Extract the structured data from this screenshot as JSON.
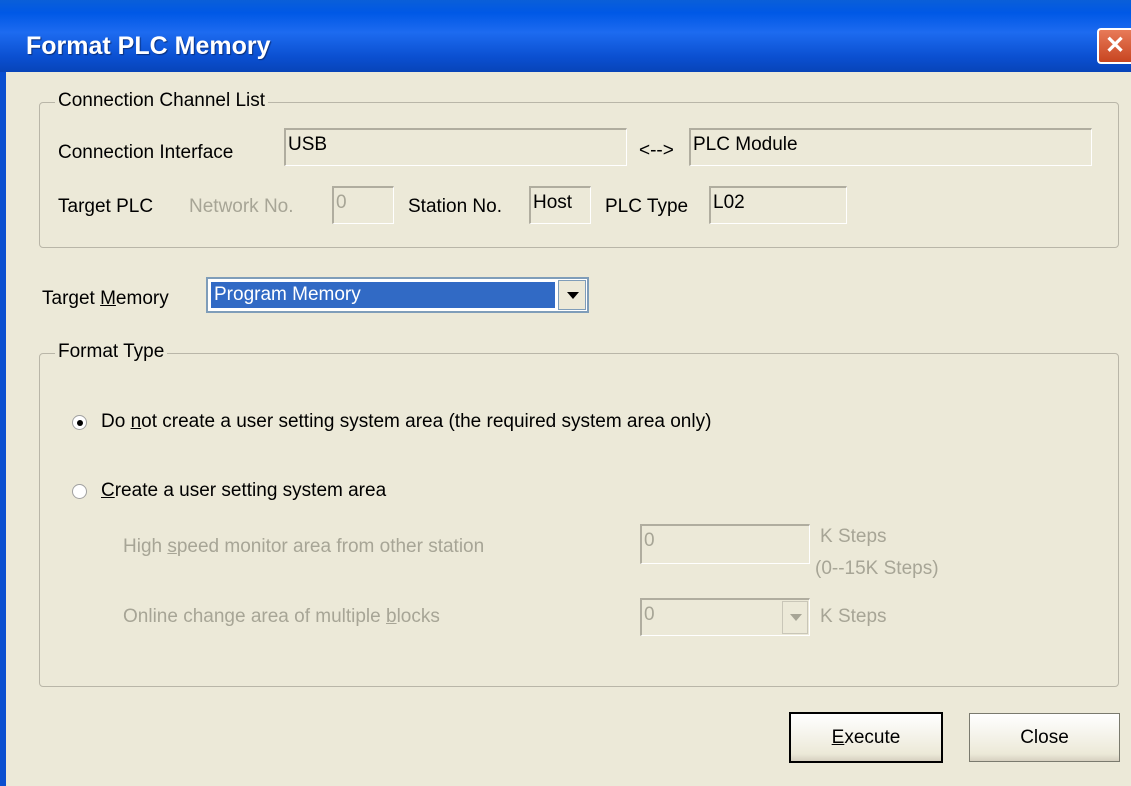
{
  "window": {
    "title": "Format PLC Memory"
  },
  "connection": {
    "group_label": "Connection Channel List",
    "interface_label": "Connection Interface",
    "interface_value": "USB",
    "arrow": "<-->",
    "module_value": "PLC Module",
    "target_plc_label": "Target PLC",
    "network_label": "Network No.",
    "network_value": "0",
    "station_label": "Station No.",
    "station_value": "Host",
    "plc_type_label": "PLC Type",
    "plc_type_value": "L02"
  },
  "target_memory": {
    "label_prefix": "Target ",
    "label_mnemonic": "M",
    "label_suffix": "emory",
    "selected": "Program Memory"
  },
  "format_type": {
    "group_label": "Format Type",
    "option1_prefix": "Do ",
    "option1_mnemonic": "n",
    "option1_suffix": "ot create a user setting system area (the required system area only)",
    "option1_selected": true,
    "option2_mnemonic": "C",
    "option2_suffix": "reate a user setting system area",
    "option2_selected": false,
    "monitor_prefix": "High ",
    "monitor_mnemonic": "s",
    "monitor_suffix": "peed monitor area from other station",
    "monitor_value": "0",
    "monitor_unit": "K Steps",
    "monitor_range": "(0--15K Steps)",
    "online_prefix": "Online change area of multiple ",
    "online_mnemonic": "b",
    "online_suffix": "locks",
    "online_value": "0",
    "online_unit": "K Steps"
  },
  "buttons": {
    "execute_mnemonic": "E",
    "execute_suffix": "xecute",
    "close": "Close"
  }
}
